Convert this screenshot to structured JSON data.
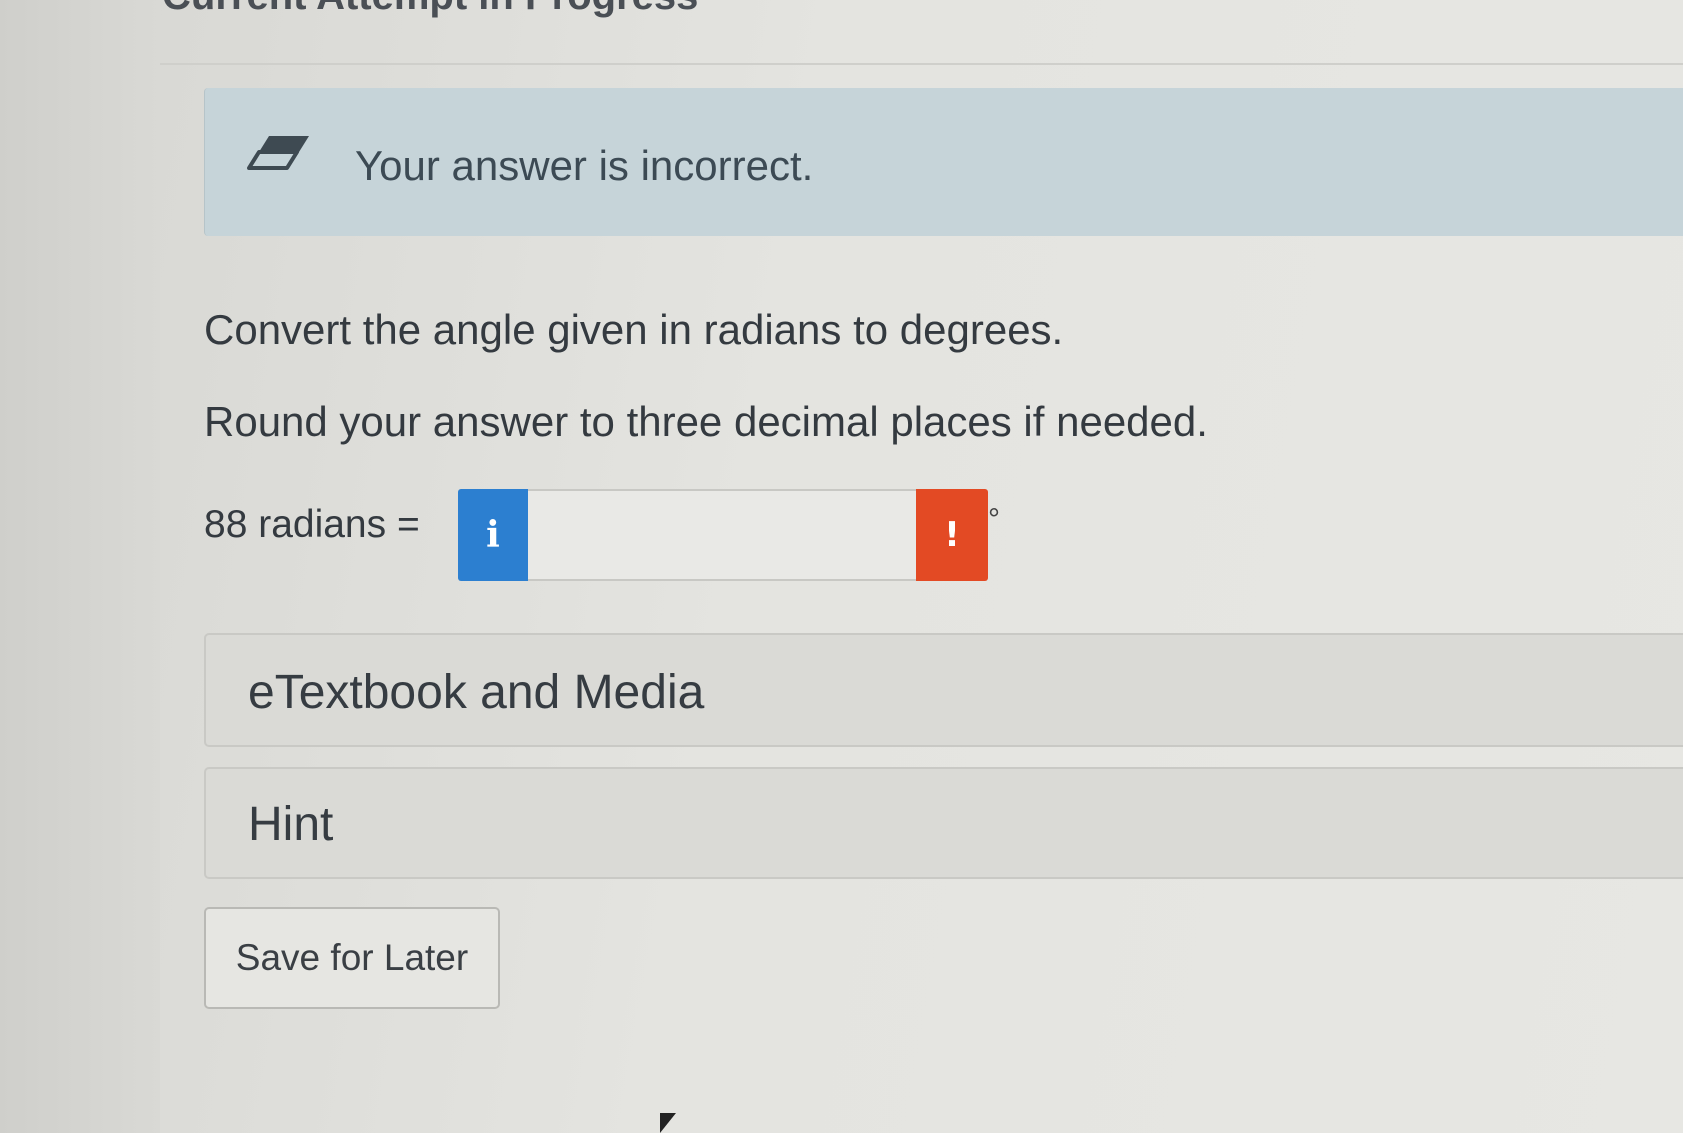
{
  "page": {
    "heading": "Current Attempt in Progress"
  },
  "feedback": {
    "icon": "eraser-icon",
    "message": "Your answer is incorrect."
  },
  "question": {
    "prompt": "Convert the angle given in radians to degrees.",
    "instruction": "Round your answer to three decimal places if needed.",
    "equation_label": "88 radians =",
    "answer_value": "",
    "info_button_label": "i",
    "error_button_label": "!",
    "unit_symbol": "°"
  },
  "panels": {
    "etextbook_label": "eTextbook and Media",
    "hint_label": "Hint"
  },
  "actions": {
    "save_label": "Save for Later"
  },
  "colors": {
    "feedback_bg": "#c6d4d9",
    "info_blue": "#2c7fd0",
    "error_orange": "#e34a24"
  }
}
